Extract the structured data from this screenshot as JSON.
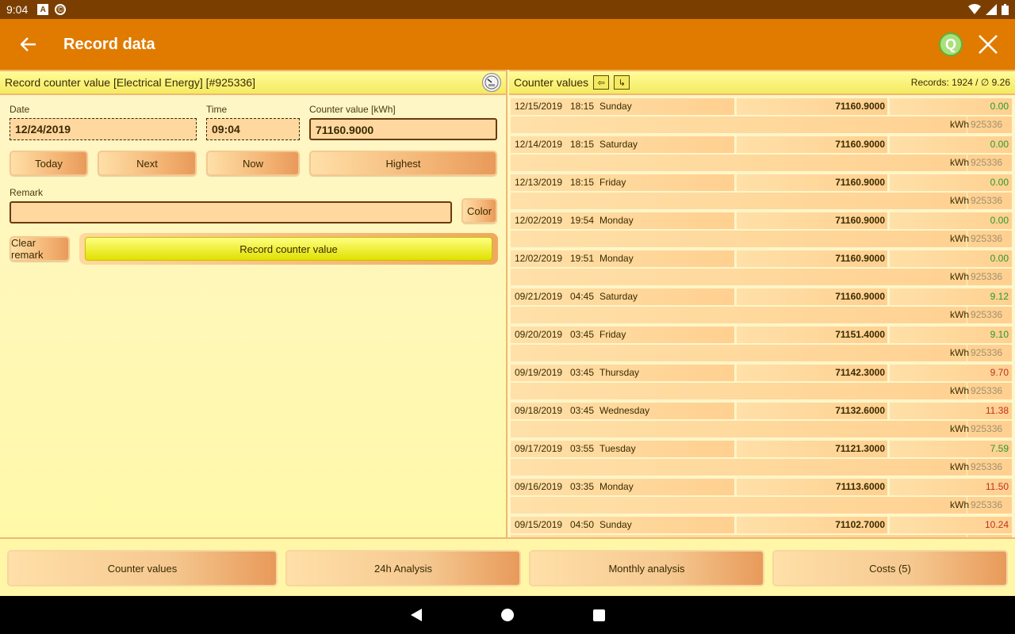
{
  "status_bar": {
    "time": "9:04",
    "icon_a": "A",
    "icon_b": "©"
  },
  "app_bar": {
    "title": "Record data",
    "q_label": "Q",
    "close_glyph": "✕",
    "back_glyph": "←"
  },
  "left": {
    "header": "Record counter value [Electrical Energy] [#925336]",
    "date_label": "Date",
    "date_value": "12/24/2019",
    "time_label": "Time",
    "time_value": "09:04",
    "counter_label": "Counter value [kWh]",
    "counter_value": "71160.9000",
    "buttons": {
      "today": "Today",
      "next": "Next",
      "now": "Now",
      "highest": "Highest",
      "color": "Color",
      "clear_remark": "Clear remark",
      "record": "Record counter value"
    },
    "remark_label": "Remark",
    "remark_value": ""
  },
  "right": {
    "header": "Counter values",
    "records_info": "Records: 1924 / ∅ 9.26",
    "records": [
      {
        "date": "12/15/2019",
        "time": "18:15",
        "day": "Sunday",
        "value": "71160.9000",
        "diff": "0.00",
        "status": "green",
        "unit": "kWh",
        "id": "925336"
      },
      {
        "date": "12/14/2019",
        "time": "18:15",
        "day": "Saturday",
        "value": "71160.9000",
        "diff": "0.00",
        "status": "green",
        "unit": "kWh",
        "id": "925336"
      },
      {
        "date": "12/13/2019",
        "time": "18:15",
        "day": "Friday",
        "value": "71160.9000",
        "diff": "0.00",
        "status": "green",
        "unit": "kWh",
        "id": "925336"
      },
      {
        "date": "12/02/2019",
        "time": "19:54",
        "day": "Monday",
        "value": "71160.9000",
        "diff": "0.00",
        "status": "green",
        "unit": "kWh",
        "id": "925336"
      },
      {
        "date": "12/02/2019",
        "time": "19:51",
        "day": "Monday",
        "value": "71160.9000",
        "diff": "0.00",
        "status": "green",
        "unit": "kWh",
        "id": "925336"
      },
      {
        "date": "09/21/2019",
        "time": "04:45",
        "day": "Saturday",
        "value": "71160.9000",
        "diff": "9.12",
        "status": "green",
        "unit": "kWh",
        "id": "925336"
      },
      {
        "date": "09/20/2019",
        "time": "03:45",
        "day": "Friday",
        "value": "71151.4000",
        "diff": "9.10",
        "status": "green",
        "unit": "kWh",
        "id": "925336"
      },
      {
        "date": "09/19/2019",
        "time": "03:45",
        "day": "Thursday",
        "value": "71142.3000",
        "diff": "9.70",
        "status": "red",
        "unit": "kWh",
        "id": "925336"
      },
      {
        "date": "09/18/2019",
        "time": "03:45",
        "day": "Wednesday",
        "value": "71132.6000",
        "diff": "11.38",
        "status": "red",
        "unit": "kWh",
        "id": "925336"
      },
      {
        "date": "09/17/2019",
        "time": "03:55",
        "day": "Tuesday",
        "value": "71121.3000",
        "diff": "7.59",
        "status": "green",
        "unit": "kWh",
        "id": "925336"
      },
      {
        "date": "09/16/2019",
        "time": "03:35",
        "day": "Monday",
        "value": "71113.6000",
        "diff": "11.50",
        "status": "red",
        "unit": "kWh",
        "id": "925336"
      },
      {
        "date": "09/15/2019",
        "time": "04:50",
        "day": "Sunday",
        "value": "71102.7000",
        "diff": "10.24",
        "status": "red",
        "unit": "kWh",
        "id": "925336"
      }
    ]
  },
  "tabs": [
    "Counter values",
    "24h Analysis",
    "Monthly analysis",
    "Costs (5)"
  ],
  "colors": {
    "status_bar": "#7a3f00",
    "app_bar": "#e07b00",
    "green": "#2a9a2a",
    "red": "#c03020"
  }
}
